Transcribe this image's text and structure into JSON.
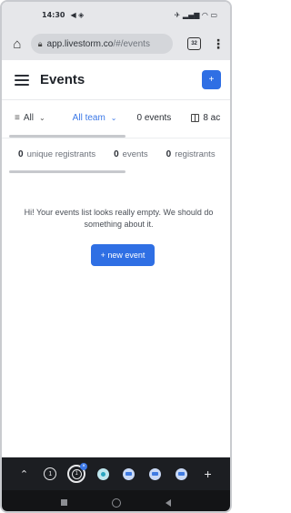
{
  "status_bar": {
    "time": "14:30",
    "notification_icons": "◀ ◈",
    "right_icons": "✈ ▂▄▆ ◠ ▭"
  },
  "browser": {
    "home_icon": "⌂",
    "url_host": "app.livestorm.co",
    "url_path": "/#/events",
    "tab_count": "32",
    "menu_icon": "⋮"
  },
  "header": {
    "title": "Events",
    "add_icon": "+"
  },
  "filters": {
    "status_filter": "All",
    "team_filter": "All team",
    "events_count_label": "0 events",
    "columns_label": "8 ac"
  },
  "stats": [
    {
      "value": "0",
      "label": "unique registrants"
    },
    {
      "value": "0",
      "label": "events"
    },
    {
      "value": "0",
      "label": "registrants"
    }
  ],
  "empty_state": {
    "message": "Hi! Your events list looks really empty. We should do something about it.",
    "button_label": "+ new event"
  },
  "tab_bar": {
    "chevron": "⌃",
    "tab1": "1",
    "tab2": "1",
    "plus": "+"
  }
}
